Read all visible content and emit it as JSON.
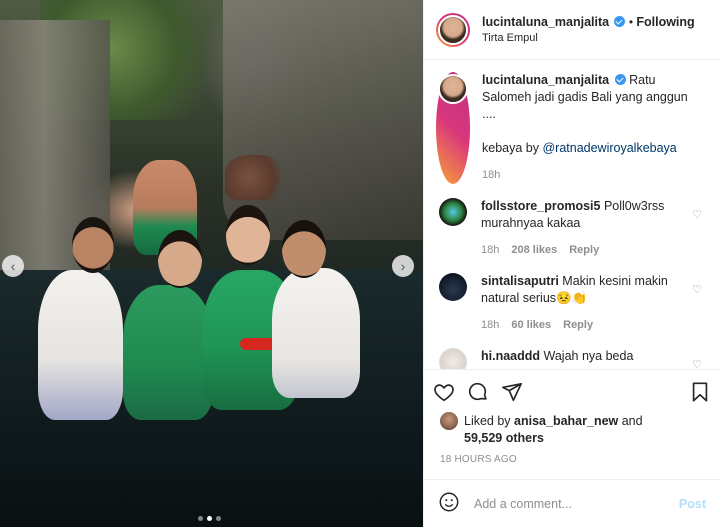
{
  "post": {
    "username": "lucintaluna_manjalita",
    "follow_dot": "•",
    "follow_label": "Following",
    "location": "Tirta Empul",
    "caption": {
      "username": "lucintaluna_manjalita",
      "text_line1": "Ratu Salomeh jadi gadis Bali yang anggun ....",
      "text_line2_prefix": "kebaya by ",
      "mention": "@ratnadewiroyalkebaya",
      "time": "18h"
    },
    "comments": [
      {
        "username": "follsstore_promosi5",
        "text": "Poll0w3rss murahnyaa kakaa",
        "time": "18h",
        "likes": "208 likes",
        "reply": "Reply"
      },
      {
        "username": "sintalisaputri",
        "text": "Makin kesini makin natural serius😣👏",
        "time": "18h",
        "likes": "60 likes",
        "reply": "Reply"
      },
      {
        "username": "hi.naaddd",
        "text": "Wajah nya beda",
        "time": "",
        "likes": "",
        "reply": ""
      }
    ],
    "liked_prefix": "Liked by ",
    "liked_user": "anisa_bahar_new",
    "liked_and": " and",
    "liked_others": "59,529 others",
    "posted_ago": "18 HOURS AGO",
    "add_comment_placeholder": "Add a comment...",
    "post_label": "Post"
  },
  "carousel": {
    "prev_label": "‹",
    "next_label": "›",
    "total_slides": 3,
    "active_slide": 2
  },
  "colors": {
    "verified": "#3897f0",
    "link": "#00376b",
    "muted": "#8e8e8e",
    "post_disabled": "#b2dffc"
  },
  "icons": [
    "heart-icon",
    "comment-icon",
    "share-icon",
    "bookmark-icon",
    "emoji-icon",
    "verified-icon",
    "chevron-left-icon",
    "chevron-right-icon"
  ]
}
